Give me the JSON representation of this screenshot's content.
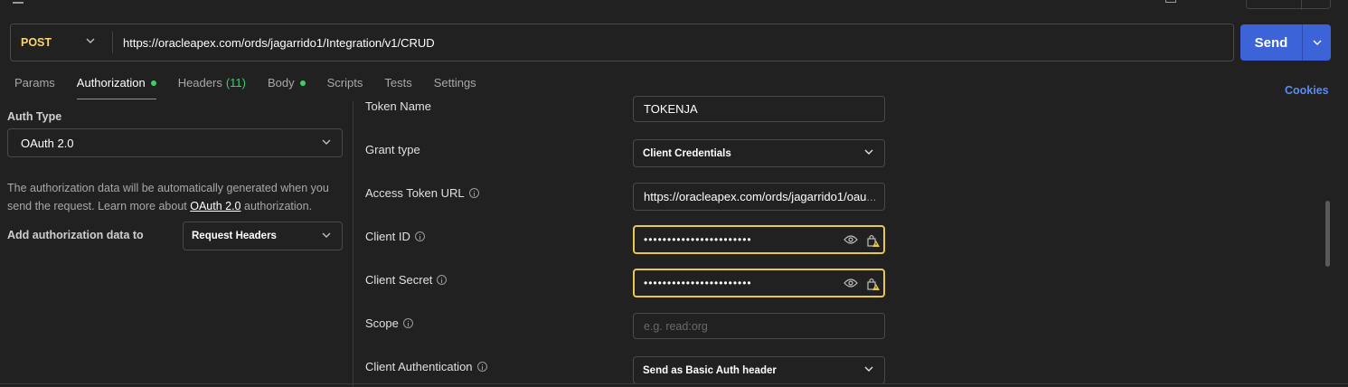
{
  "request": {
    "method": "POST",
    "url": "https://oracleapex.com/ords/jagarrido1/Integration/v1/CRUD",
    "send_label": "Send"
  },
  "tabs": [
    {
      "label": "Params"
    },
    {
      "label": "Authorization"
    },
    {
      "label": "Headers",
      "count": "(11)"
    },
    {
      "label": "Body"
    },
    {
      "label": "Scripts"
    },
    {
      "label": "Tests"
    },
    {
      "label": "Settings"
    }
  ],
  "cookies_label": "Cookies",
  "auth": {
    "type_label": "Auth Type",
    "type_value": "OAuth 2.0",
    "description_pre": "The authorization data will be automatically generated when you send the request. Learn more about ",
    "description_link": "OAuth 2.0",
    "description_post": " authorization.",
    "add_to_label": "Add authorization data to",
    "add_to_value": "Request Headers"
  },
  "oauth": {
    "token_name_label": "Token Name",
    "token_name_value": "TOKENJA",
    "grant_type_label": "Grant type",
    "grant_type_value": "Client Credentials",
    "access_token_url_label": "Access Token URL",
    "access_token_url_value": "https://oracleapex.com/ords/jagarrido1/oau",
    "access_token_url_ellipsis": "...",
    "client_id_label": "Client ID",
    "client_id_value": "•••••••••••••••••••••••",
    "client_secret_label": "Client Secret",
    "client_secret_value": "•••••••••••••••••••••••",
    "scope_label": "Scope",
    "scope_placeholder": "e.g. read:org",
    "client_auth_label": "Client Authentication",
    "client_auth_value": "Send as Basic Auth header"
  },
  "colors": {
    "background": "#212121",
    "send_button": "#3d63d8",
    "method": "#f5d76e",
    "active_tab_underline": "#ff6c37",
    "status_dot": "#3ecf6a",
    "link": "#5b8cf5",
    "highlight_border": "#e6c84c"
  },
  "icons": [
    "back-arrow-icon",
    "chevron-down-icon",
    "info-icon",
    "eye-icon",
    "lock-warning-icon"
  ]
}
